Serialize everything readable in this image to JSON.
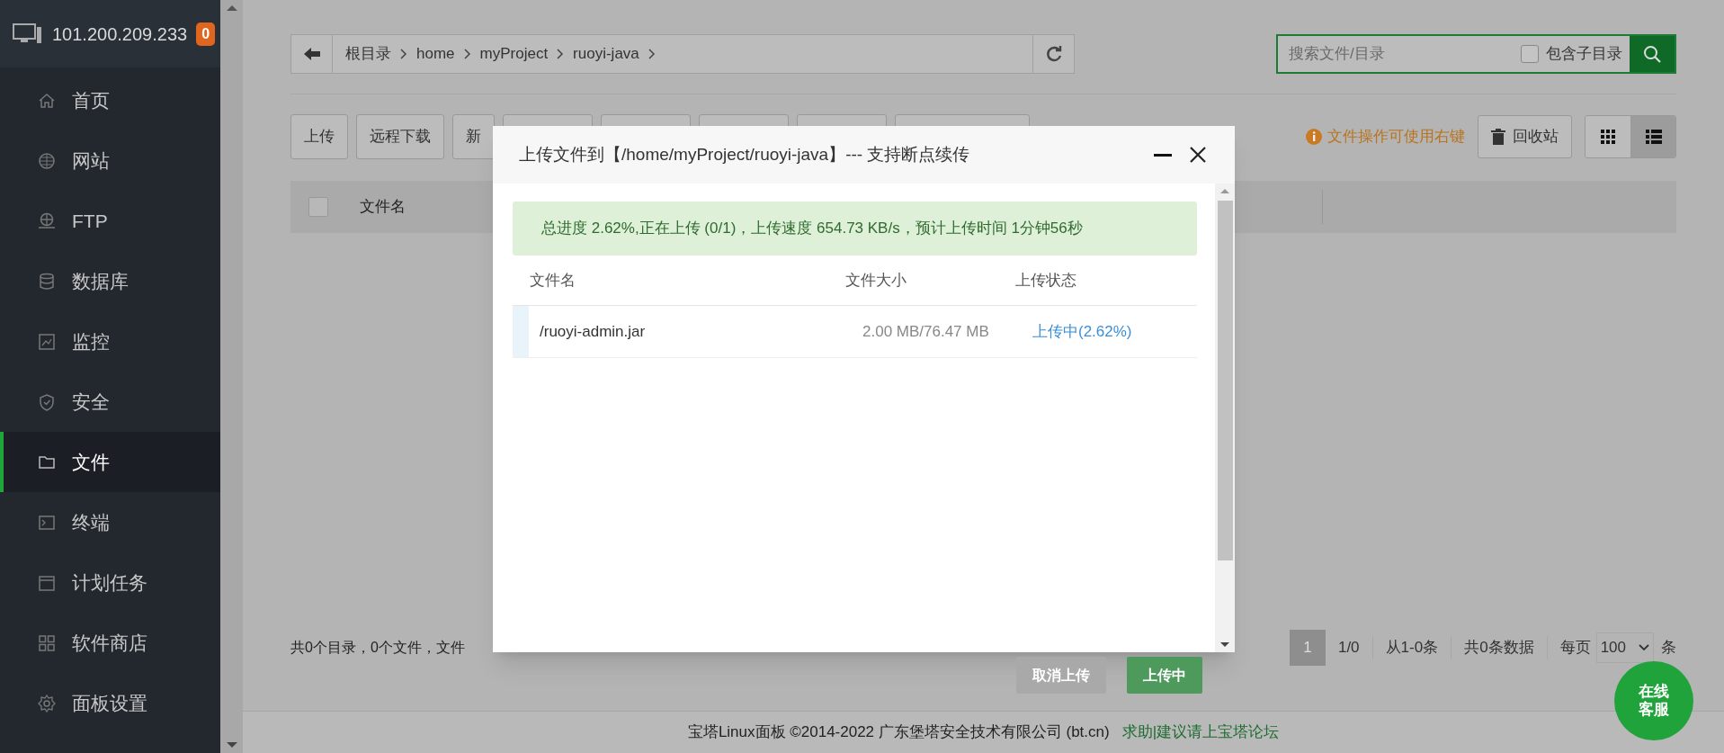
{
  "server": {
    "ip": "101.200.209.233",
    "badge": "0"
  },
  "sidebar": {
    "items": [
      {
        "label": "首页",
        "selected": false
      },
      {
        "label": "网站",
        "selected": false
      },
      {
        "label": "FTP",
        "selected": false
      },
      {
        "label": "数据库",
        "selected": false
      },
      {
        "label": "监控",
        "selected": false
      },
      {
        "label": "安全",
        "selected": false
      },
      {
        "label": "文件",
        "selected": true
      },
      {
        "label": "终端",
        "selected": false
      },
      {
        "label": "计划任务",
        "selected": false
      },
      {
        "label": "软件商店",
        "selected": false
      },
      {
        "label": "面板设置",
        "selected": false
      }
    ]
  },
  "breadcrumb": [
    "根目录",
    "home",
    "myProject",
    "ruoyi-java"
  ],
  "search": {
    "placeholder": "搜索文件/目录",
    "subdir_label": "包含子目录",
    "subdir_checked": false
  },
  "toolbar": {
    "buttons": [
      "上传",
      "远程下载",
      "新"
    ],
    "hint": "文件操作可使用右键",
    "recycle": "回收站",
    "views": [
      {
        "kind": "grid",
        "selected": false
      },
      {
        "kind": "list",
        "selected": true
      }
    ]
  },
  "table": {
    "columns": [
      "文件名"
    ],
    "all_checked": false
  },
  "summary": "共0个目录，0个文件，文件",
  "pagination": {
    "pages": [
      {
        "label": "1",
        "selected": true
      }
    ],
    "page_info": "1/0",
    "range": "从1-0条",
    "total": "共0条数据",
    "per_page_label": "每页",
    "per_page": "100",
    "per_page_unit": "条"
  },
  "dialog": {
    "title": "上传文件到【/home/myProject/ruoyi-java】--- 支持断点续传",
    "progress": "总进度 2.62%,正在上传 (0/1)，上传速度 654.73 KB/s，预计上传时间 1分钟56秒",
    "columns": [
      "文件名",
      "文件大小",
      "上传状态"
    ],
    "files": [
      {
        "name": "/ruoyi-admin.jar",
        "size": "2.00 MB/76.47 MB",
        "status": "上传中(2.62%)"
      }
    ],
    "buttons": [
      {
        "label": "取消上传",
        "kind": "cancel"
      },
      {
        "label": "上传中",
        "kind": "primary"
      }
    ]
  },
  "footer": {
    "copyright": "宝塔Linux面板 ©2014-2022 广东堡塔安全技术有限公司 (bt.cn)",
    "link": "求助|建议请上宝塔论坛"
  },
  "support": {
    "label": "在线客服"
  }
}
